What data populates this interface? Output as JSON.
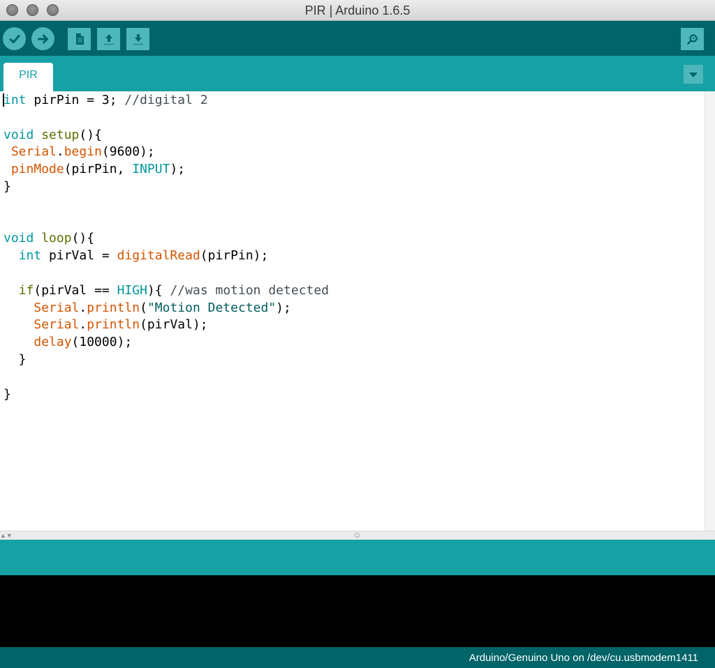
{
  "window": {
    "title": "PIR | Arduino 1.6.5"
  },
  "toolbar": {
    "buttons": [
      {
        "name": "verify",
        "icon": "checkmark-icon"
      },
      {
        "name": "upload",
        "icon": "arrow-right-icon"
      },
      {
        "name": "new",
        "icon": "document-icon"
      },
      {
        "name": "open",
        "icon": "arrow-up-icon"
      },
      {
        "name": "save",
        "icon": "arrow-down-icon"
      },
      {
        "name": "serial-monitor",
        "icon": "magnifier-icon"
      }
    ]
  },
  "tabs": [
    {
      "label": "PIR",
      "active": true
    }
  ],
  "editor": {
    "lines": [
      [
        {
          "t": "int",
          "c": "kw"
        },
        {
          "t": " pirPin = 3; ",
          "c": ""
        },
        {
          "t": "//digital 2",
          "c": "cmt"
        }
      ],
      [],
      [
        {
          "t": "void",
          "c": "kw"
        },
        {
          "t": " ",
          "c": ""
        },
        {
          "t": "setup",
          "c": "fl"
        },
        {
          "t": "(){",
          "c": ""
        }
      ],
      [
        {
          "t": " ",
          "c": ""
        },
        {
          "t": "Serial",
          "c": "fn"
        },
        {
          "t": ".",
          "c": ""
        },
        {
          "t": "begin",
          "c": "fn"
        },
        {
          "t": "(9600);",
          "c": ""
        }
      ],
      [
        {
          "t": " ",
          "c": ""
        },
        {
          "t": "pinMode",
          "c": "fn"
        },
        {
          "t": "(pirPin, ",
          "c": ""
        },
        {
          "t": "INPUT",
          "c": "cst"
        },
        {
          "t": ");",
          "c": ""
        }
      ],
      [
        {
          "t": "}",
          "c": ""
        }
      ],
      [],
      [],
      [
        {
          "t": "void",
          "c": "kw"
        },
        {
          "t": " ",
          "c": ""
        },
        {
          "t": "loop",
          "c": "fl"
        },
        {
          "t": "(){",
          "c": ""
        }
      ],
      [
        {
          "t": "  ",
          "c": ""
        },
        {
          "t": "int",
          "c": "kw"
        },
        {
          "t": " pirVal = ",
          "c": ""
        },
        {
          "t": "digitalRead",
          "c": "fn"
        },
        {
          "t": "(pirPin);",
          "c": ""
        }
      ],
      [],
      [
        {
          "t": "  ",
          "c": ""
        },
        {
          "t": "if",
          "c": "fl"
        },
        {
          "t": "(pirVal == ",
          "c": ""
        },
        {
          "t": "HIGH",
          "c": "cst"
        },
        {
          "t": "){ ",
          "c": ""
        },
        {
          "t": "//was motion detected",
          "c": "cmt"
        }
      ],
      [
        {
          "t": "    ",
          "c": ""
        },
        {
          "t": "Serial",
          "c": "fn"
        },
        {
          "t": ".",
          "c": ""
        },
        {
          "t": "println",
          "c": "fn"
        },
        {
          "t": "(",
          "c": ""
        },
        {
          "t": "\"Motion Detected\"",
          "c": "str"
        },
        {
          "t": ");",
          "c": ""
        }
      ],
      [
        {
          "t": "    ",
          "c": ""
        },
        {
          "t": "Serial",
          "c": "fn"
        },
        {
          "t": ".",
          "c": ""
        },
        {
          "t": "println",
          "c": "fn"
        },
        {
          "t": "(pirVal);",
          "c": ""
        }
      ],
      [
        {
          "t": "    ",
          "c": ""
        },
        {
          "t": "delay",
          "c": "fn"
        },
        {
          "t": "(10000);",
          "c": ""
        }
      ],
      [
        {
          "t": "  }",
          "c": ""
        }
      ],
      [],
      [
        {
          "t": "}",
          "c": ""
        }
      ]
    ]
  },
  "status": {
    "board": "Arduino/Genuino Uno on /dev/cu.usbmodem1411"
  },
  "colors": {
    "toolbar_bg": "#006468",
    "tabbar_bg": "#17a1a5",
    "button_bg": "#4db7bb",
    "keyword": "#00979c",
    "function": "#d35400",
    "flow": "#5e6d03",
    "comment": "#434f54"
  }
}
